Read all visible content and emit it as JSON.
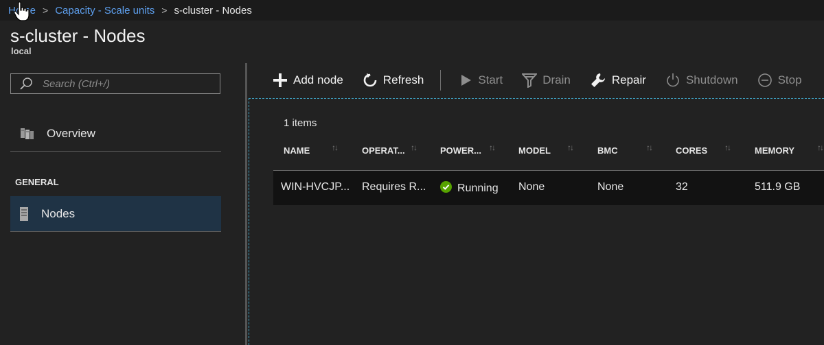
{
  "breadcrumb": {
    "items": [
      "Home",
      "Capacity - Scale units"
    ],
    "current": "s-cluster - Nodes",
    "separator": ">"
  },
  "page": {
    "title": "s-cluster - Nodes",
    "subtitle": "local"
  },
  "search": {
    "placeholder": "Search (Ctrl+/)",
    "icon": "search-icon"
  },
  "sidebar": {
    "overview_label": "Overview",
    "section_label": "GENERAL",
    "nodes_label": "Nodes"
  },
  "toolbar": {
    "add_node": "Add node",
    "refresh": "Refresh",
    "start": "Start",
    "drain": "Drain",
    "repair": "Repair",
    "shutdown": "Shutdown",
    "stop": "Stop"
  },
  "table": {
    "count_label": "1 items",
    "columns": [
      "NAME",
      "OPERAT...",
      "POWER...",
      "MODEL",
      "BMC",
      "CORES",
      "MEMORY"
    ],
    "rows": [
      {
        "name": "WIN-HVCJP...",
        "operational": "Requires R...",
        "power": "Running",
        "model": "None",
        "bmc": "None",
        "cores": "32",
        "memory": "511.9 GB"
      }
    ]
  },
  "colors": {
    "accent_link": "#5ea0ef",
    "status_ok": "#57a300",
    "selected_nav": "#1f3345"
  }
}
